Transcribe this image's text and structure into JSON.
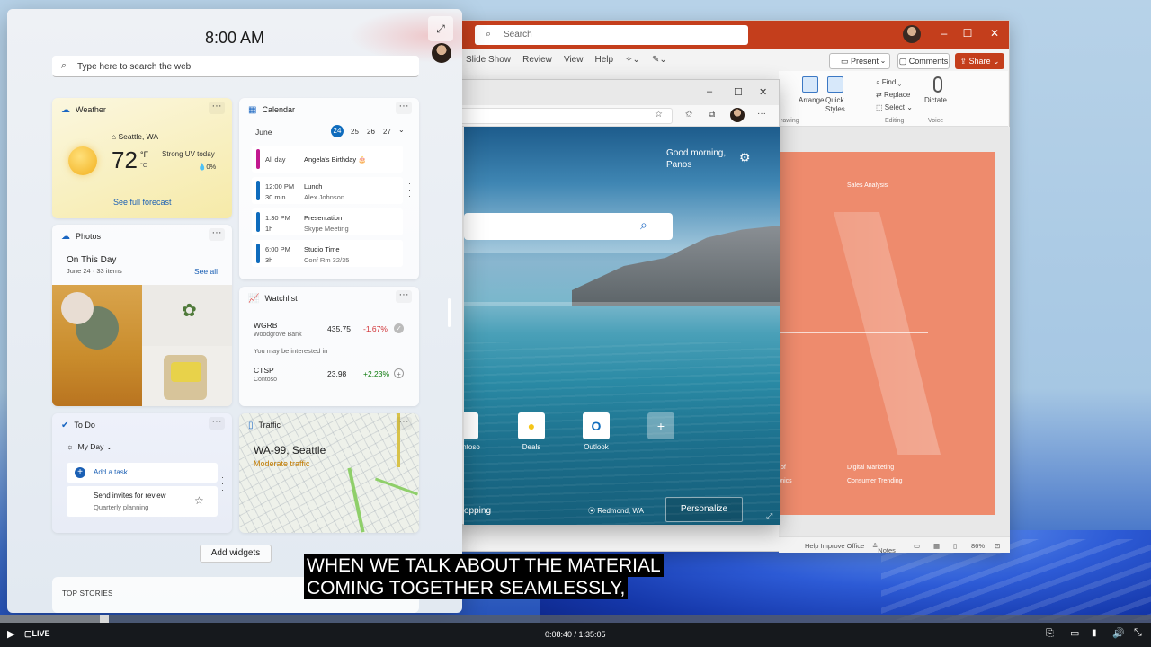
{
  "powerpoint": {
    "search_placeholder": "Search",
    "menu": [
      "Slide Show",
      "Review",
      "View",
      "Help"
    ],
    "present_label": "Present",
    "comments_label": "Comments",
    "share_label": "Share",
    "ribbon": {
      "arrange": "Arrange",
      "quick_styles": "Quick Styles",
      "find": "Find",
      "replace": "Replace",
      "select": "Select",
      "dictate": "Dictate",
      "group_drawing": "rawing",
      "group_editing": "Editing",
      "group_voice": "Voice"
    },
    "slide": {
      "title": "Sales Analysis",
      "items_left": [
        "of",
        "ronics"
      ],
      "items_right": [
        "Digital Marketing",
        "Consumer Trending"
      ]
    },
    "status": {
      "help": "Help Improve Office",
      "notes": "Notes",
      "zoom": "86%"
    },
    "accent": "#c43e1c"
  },
  "edge": {
    "greeting_line1": "Good morning,",
    "greeting_line2": "Panos",
    "tiles": [
      {
        "label": "ntoso",
        "icon": "contoso-icon"
      },
      {
        "label": "Deals",
        "icon": "deals-icon"
      },
      {
        "label": "Outlook",
        "icon": "outlook-icon"
      }
    ],
    "shopping": "opping",
    "location": "Redmond, WA",
    "personalize": "Personalize"
  },
  "widgets": {
    "time": "8:00 AM",
    "search_placeholder": "Type here to search the web",
    "weather": {
      "title": "Weather",
      "location": "Seattle, WA",
      "temp": "72",
      "unit_f": "°F",
      "unit_c": "°C",
      "condition": "Strong UV today",
      "precip": "0%",
      "forecast_link": "See full forecast"
    },
    "calendar": {
      "title": "Calendar",
      "month": "June",
      "days": [
        "24",
        "25",
        "26",
        "27"
      ],
      "events": [
        {
          "time": "All day",
          "duration": "",
          "title": "Angela's Birthday 🎂",
          "sub": "",
          "color": "#c2188f"
        },
        {
          "time": "12:00 PM",
          "duration": "30 min",
          "title": "Lunch",
          "sub": "Alex Johnson",
          "color": "#0f6cbd"
        },
        {
          "time": "1:30 PM",
          "duration": "1h",
          "title": "Presentation",
          "sub": "Skype Meeting",
          "color": "#0f6cbd"
        },
        {
          "time": "6:00 PM",
          "duration": "3h",
          "title": "Studio Time",
          "sub": "Conf Rm 32/35",
          "color": "#0f6cbd"
        }
      ]
    },
    "photos": {
      "title": "Photos",
      "heading": "On This Day",
      "sub": "June 24 · 33 items",
      "see_all": "See all"
    },
    "watchlist": {
      "title": "Watchlist",
      "stocks": [
        {
          "symbol": "WGRB",
          "name": "Woodgrove Bank",
          "price": "435.75",
          "change": "-1.67%",
          "color": "#d13438"
        },
        {
          "symbol": "CTSP",
          "name": "Contoso",
          "price": "23.98",
          "change": "+2.23%",
          "color": "#107c10"
        }
      ],
      "interest_label": "You may be interested in"
    },
    "todo": {
      "title": "To Do",
      "list": "My Day",
      "add_task": "Add a task",
      "task_title": "Send invites for review",
      "task_sub": "Quarterly planning"
    },
    "traffic": {
      "title": "Traffic",
      "road": "WA-99, Seattle",
      "status": "Moderate traffic"
    },
    "add_widgets": "Add widgets",
    "top_stories": "TOP STORIES"
  },
  "caption": {
    "line1": "WHEN WE TALK ABOUT THE MATERIAL",
    "line2": "COMING TOGETHER SEAMLESSLY,"
  },
  "player": {
    "live": "LIVE",
    "time": "0:08:40 / 1:35:05",
    "progress": 0.091
  }
}
